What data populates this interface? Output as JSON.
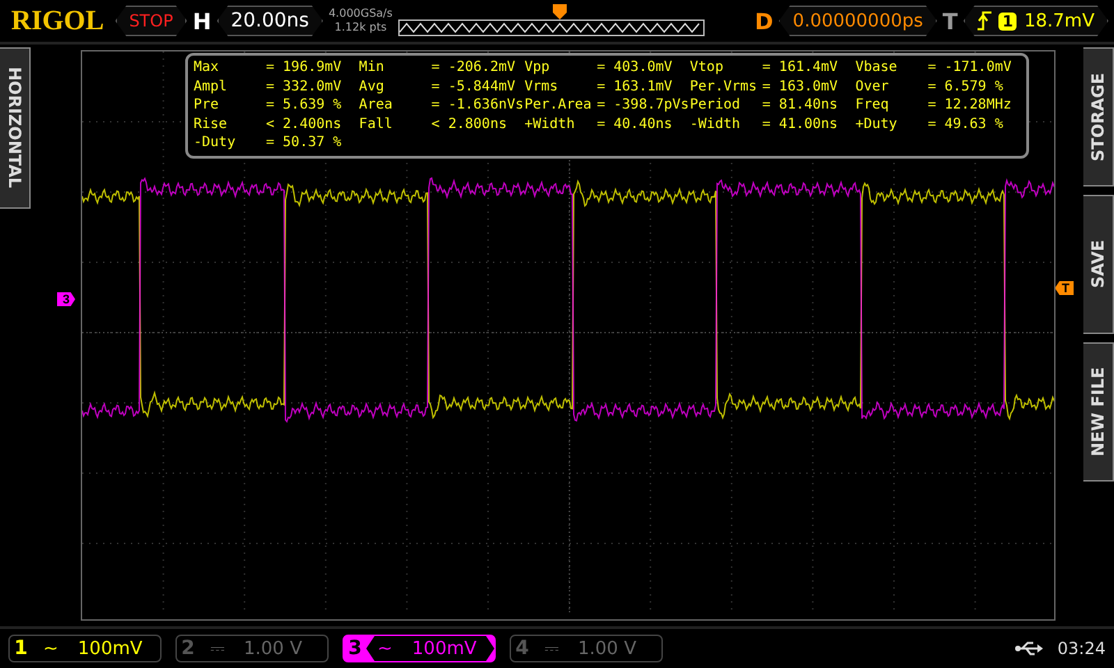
{
  "brand": "RIGOL",
  "run_state": "STOP",
  "horizontal": {
    "label": "H",
    "timebase": "20.00ns",
    "sample_rate": "4.000GSa/s",
    "memory_depth": "1.12k pts"
  },
  "delay": {
    "label": "D",
    "value": "0.00000000ps"
  },
  "trigger": {
    "label": "T",
    "source": "1",
    "level": "18.7mV"
  },
  "left_menu": [
    "HORIZONTAL"
  ],
  "right_menu": [
    "STORAGE",
    "SAVE",
    "NEW FILE"
  ],
  "channel_marker": "3",
  "trigger_marker": "T",
  "measurements": [
    {
      "label": "Max",
      "value": "= 196.9mV"
    },
    {
      "label": "Min",
      "value": "= -206.2mV"
    },
    {
      "label": "Vpp",
      "value": "= 403.0mV"
    },
    {
      "label": "Vtop",
      "value": "= 161.4mV"
    },
    {
      "label": "Vbase",
      "value": "= -171.0mV"
    },
    {
      "label": "Ampl",
      "value": "= 332.0mV"
    },
    {
      "label": "Avg",
      "value": "= -5.844mV"
    },
    {
      "label": "Vrms",
      "value": "= 163.1mV"
    },
    {
      "label": "Per.Vrms",
      "value": "= 163.0mV"
    },
    {
      "label": "Over",
      "value": "= 6.579 %"
    },
    {
      "label": "Pre",
      "value": "= 5.639 %"
    },
    {
      "label": "Area",
      "value": "= -1.636nVs"
    },
    {
      "label": "Per.Area",
      "value": "= -398.7pVs"
    },
    {
      "label": "Period",
      "value": "= 81.40ns"
    },
    {
      "label": "Freq",
      "value": "= 12.28MHz"
    },
    {
      "label": "Rise",
      "value": "< 2.400ns"
    },
    {
      "label": "Fall",
      "value": "< 2.800ns"
    },
    {
      "label": "+Width",
      "value": "= 40.40ns"
    },
    {
      "label": "-Width",
      "value": "= 41.00ns"
    },
    {
      "label": "+Duty",
      "value": "= 49.63 %"
    },
    {
      "label": "-Duty",
      "value": "= 50.37 %"
    }
  ],
  "channels": [
    {
      "number": "1",
      "coupling": "~",
      "scale": "100mV",
      "enabled": true,
      "selected": false,
      "color": "#ffff00"
    },
    {
      "number": "2",
      "coupling": "⎓",
      "scale": "1.00 V",
      "enabled": false,
      "selected": false
    },
    {
      "number": "3",
      "coupling": "~",
      "scale": "100mV",
      "enabled": true,
      "selected": true,
      "color": "#ff00ff"
    },
    {
      "number": "4",
      "coupling": "⎓",
      "scale": "1.00 V",
      "enabled": false,
      "selected": false
    }
  ],
  "clock": "03:24"
}
